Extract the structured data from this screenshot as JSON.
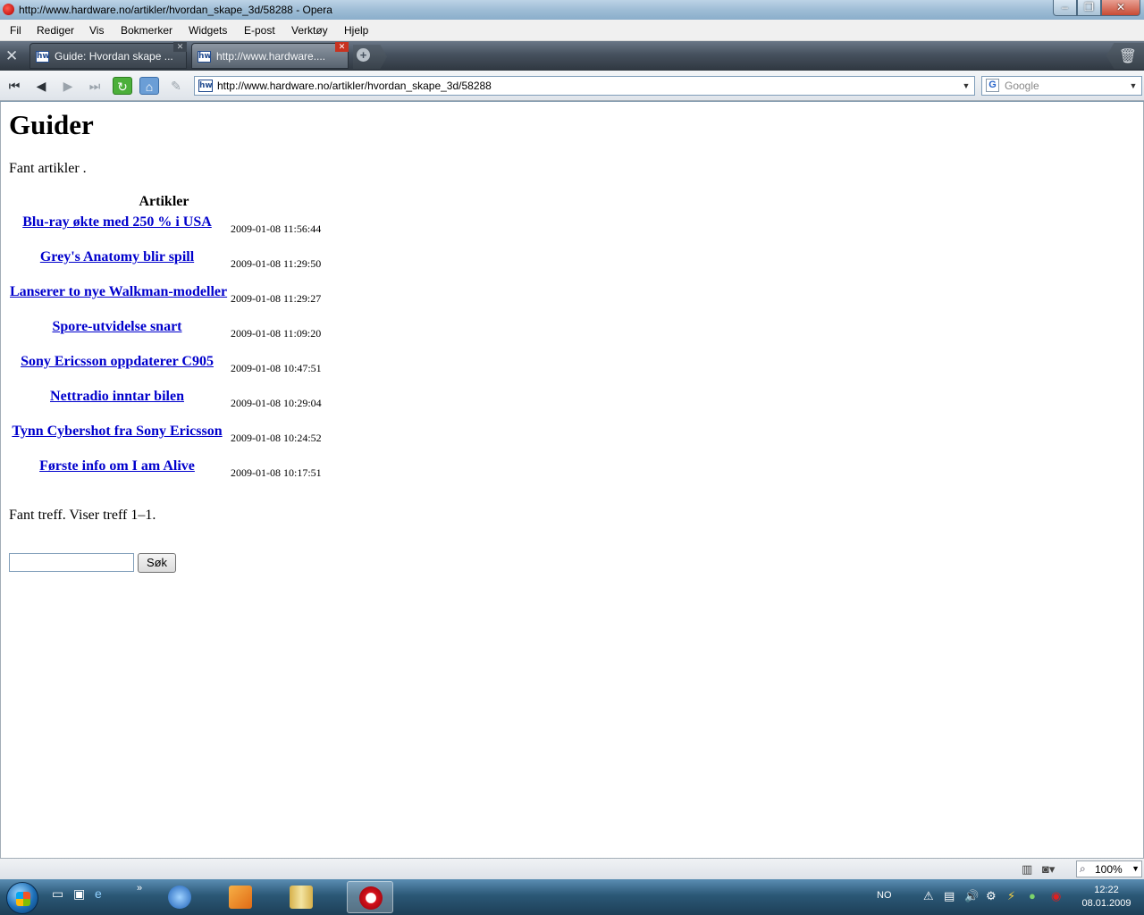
{
  "window": {
    "title": "http://www.hardware.no/artikler/hvordan_skape_3d/58288 - Opera",
    "minimize": "‒",
    "restore": "❐",
    "close": "✕"
  },
  "menu": [
    "Fil",
    "Rediger",
    "Vis",
    "Bokmerker",
    "Widgets",
    "E-post",
    "Verktøy",
    "Hjelp"
  ],
  "tabs": [
    {
      "title": "Guide: Hvordan skape ...",
      "favicon": "hw",
      "active": false
    },
    {
      "title": "http://www.hardware....",
      "favicon": "hw",
      "active": true
    }
  ],
  "address": {
    "url": "http://www.hardware.no/artikler/hvordan_skape_3d/58288",
    "favicon": "hw"
  },
  "search": {
    "placeholder": "Google",
    "engine_icon": "G"
  },
  "page": {
    "title": "Guider",
    "found_text": "Fant artikler .",
    "articles_header": "Artikler",
    "articles": [
      {
        "title": "Blu-ray økte med 250 % i USA",
        "date": "2009-01-08 11:56:44"
      },
      {
        "title": "Grey's Anatomy blir spill",
        "date": "2009-01-08 11:29:50"
      },
      {
        "title": "Lanserer to nye Walkman-modeller",
        "date": "2009-01-08 11:29:27"
      },
      {
        "title": "Spore-utvidelse snart",
        "date": "2009-01-08 11:09:20"
      },
      {
        "title": "Sony Ericsson oppdaterer C905",
        "date": "2009-01-08 10:47:51"
      },
      {
        "title": "Nettradio inntar bilen",
        "date": "2009-01-08 10:29:04"
      },
      {
        "title": "Tynn Cybershot fra Sony Ericsson",
        "date": "2009-01-08 10:24:52"
      },
      {
        "title": "Første info om I am Alive",
        "date": "2009-01-08 10:17:51"
      }
    ],
    "results_text": "Fant treff. Viser treff 1–1.",
    "search_value": "",
    "search_button": "Søk"
  },
  "statusbar": {
    "zoom": "100%"
  },
  "taskbar": {
    "language": "NO",
    "time": "12:22",
    "date": "08.01.2009"
  },
  "colors": {
    "link": "#0000cc",
    "active_tab_close": "#c8321f"
  }
}
